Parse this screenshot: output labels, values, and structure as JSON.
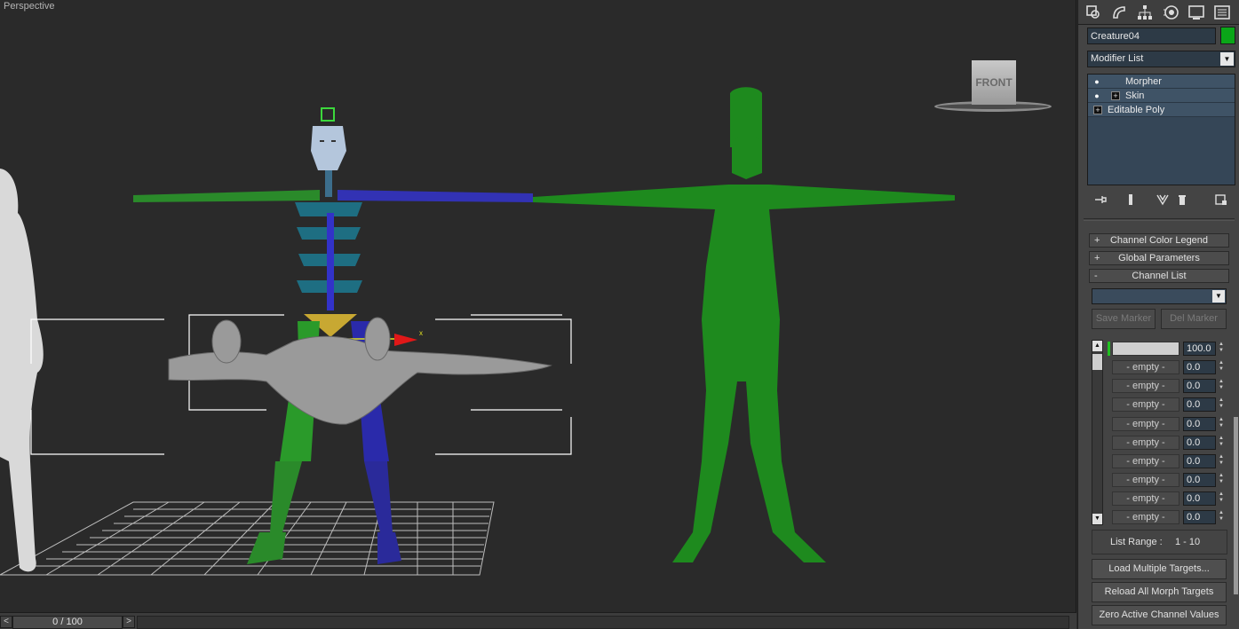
{
  "viewport": {
    "label": "Perspective",
    "viewcube_label": "FRONT"
  },
  "timeline": {
    "frame_display": "0 / 100",
    "prev_glyph": "<",
    "next_glyph": ">"
  },
  "command_panel": {
    "tabs": [
      {
        "id": "create",
        "icon": "create-icon"
      },
      {
        "id": "modify",
        "icon": "modify-icon"
      },
      {
        "id": "hierarchy",
        "icon": "hierarchy-icon"
      },
      {
        "id": "motion",
        "icon": "motion-icon"
      },
      {
        "id": "display",
        "icon": "display-icon"
      },
      {
        "id": "utilities",
        "icon": "utilities-icon"
      }
    ],
    "object_name": "Creature04",
    "object_color": "#0aa618",
    "modifier_list_label": "Modifier List",
    "stack": [
      {
        "label": "Morpher"
      },
      {
        "label": "Skin"
      },
      {
        "label": "Editable Poly"
      }
    ],
    "rollouts": {
      "channel_color_legend": {
        "sign": "+",
        "label": "Channel Color Legend"
      },
      "global_parameters": {
        "sign": "+",
        "label": "Global Parameters"
      },
      "channel_list": {
        "sign": "-",
        "label": "Channel List"
      }
    },
    "save_marker": "Save Marker",
    "del_marker": "Del Marker",
    "channels": [
      {
        "name": "",
        "value": "100.0"
      },
      {
        "name": "- empty -",
        "value": "0.0"
      },
      {
        "name": "- empty -",
        "value": "0.0"
      },
      {
        "name": "- empty -",
        "value": "0.0"
      },
      {
        "name": "- empty -",
        "value": "0.0"
      },
      {
        "name": "- empty -",
        "value": "0.0"
      },
      {
        "name": "- empty -",
        "value": "0.0"
      },
      {
        "name": "- empty -",
        "value": "0.0"
      },
      {
        "name": "- empty -",
        "value": "0.0"
      },
      {
        "name": "- empty -",
        "value": "0.0"
      }
    ],
    "list_range_label": "List Range :",
    "list_range_value": "1 - 10",
    "load_multiple_targets": "Load Multiple Targets...",
    "reload_all_morph_targets": "Reload All Morph Targets",
    "zero_active_channel_values": "Zero Active Channel Values"
  }
}
